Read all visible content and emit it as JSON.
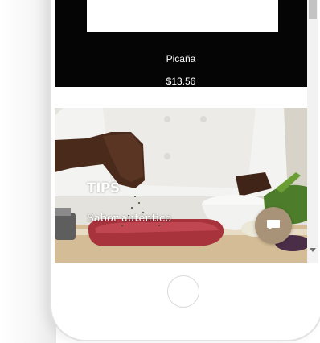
{
  "product": {
    "name": "Picaña",
    "price": "$13.56"
  },
  "hero": {
    "title": "TIPS",
    "subtitle": "Sabor auténtico"
  },
  "icons": {
    "chat": "chat-bubble-icon",
    "scroll_down": "arrow-down-icon"
  },
  "colors": {
    "product_card_bg": "#050505",
    "chat_button_bg": "#a89278"
  }
}
